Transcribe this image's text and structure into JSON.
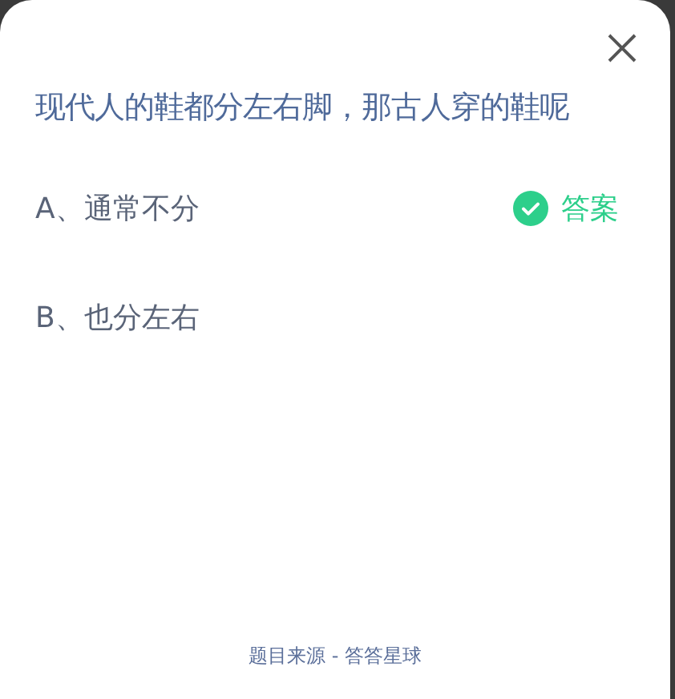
{
  "question": "现代人的鞋都分左右脚，那古人穿的鞋呢",
  "options": [
    {
      "label": "A、通常不分",
      "correct": true,
      "answer_label": "答案"
    },
    {
      "label": "B、也分左右",
      "correct": false
    }
  ],
  "footer": "题目来源 - 答答星球"
}
